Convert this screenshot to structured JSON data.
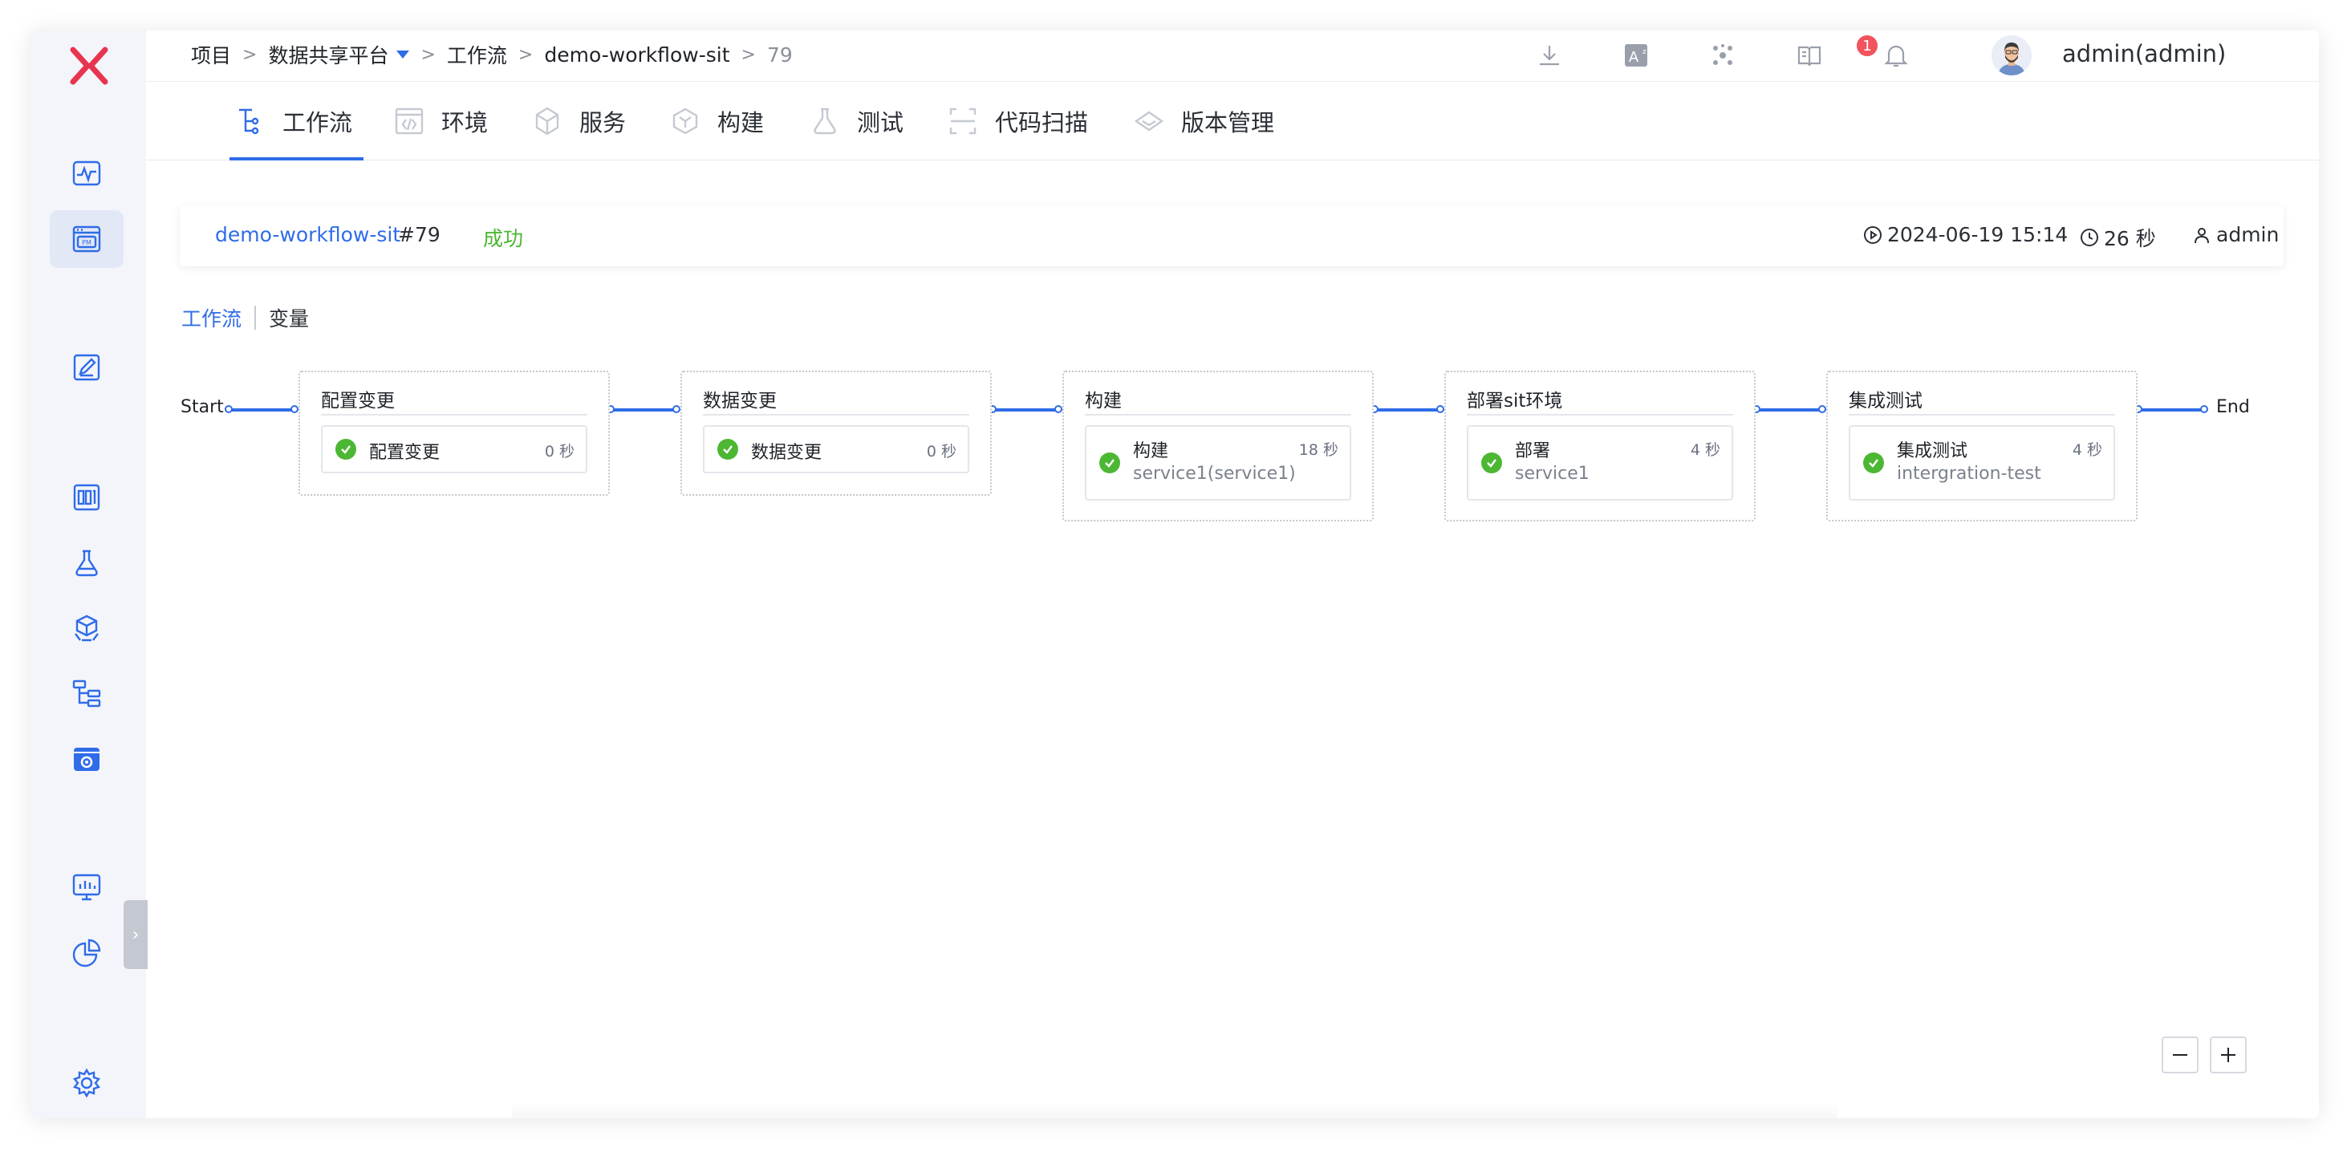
{
  "breadcrumb": [
    "项目",
    "数据共享平台",
    "工作流",
    "demo-workflow-sit",
    "79"
  ],
  "breadcrumb_separator": ">",
  "topbar": {
    "icons": [
      "download-icon",
      "translate-icon",
      "network-icon",
      "docs-icon",
      "bell-icon"
    ],
    "notification_count": "1",
    "username": "admin(admin)"
  },
  "tabs": [
    {
      "label": "工作流",
      "icon": "workflow-icon",
      "active": true
    },
    {
      "label": "环境",
      "icon": "environment-icon"
    },
    {
      "label": "服务",
      "icon": "service-icon"
    },
    {
      "label": "构建",
      "icon": "build-icon"
    },
    {
      "label": "测试",
      "icon": "test-icon"
    },
    {
      "label": "代码扫描",
      "icon": "scan-icon"
    },
    {
      "label": "版本管理",
      "icon": "version-icon"
    }
  ],
  "task": {
    "workflow_name": "demo-workflow-sit",
    "run_number": "#79",
    "status": "成功",
    "start_time": "2024-06-19 15:14",
    "duration": "26 秒",
    "creator": "admin"
  },
  "subtabs": [
    "工作流",
    "变量"
  ],
  "pipeline": {
    "start_label": "Start",
    "end_label": "End",
    "stages": [
      {
        "title": "配置变更",
        "job": {
          "name": "配置变更",
          "time": "0 秒",
          "sub": ""
        }
      },
      {
        "title": "数据变更",
        "job": {
          "name": "数据变更",
          "time": "0 秒",
          "sub": ""
        }
      },
      {
        "title": "构建",
        "job": {
          "name": "构建",
          "time": "18 秒",
          "sub": "service1(service1)"
        }
      },
      {
        "title": "部署sit环境",
        "job": {
          "name": "部署",
          "time": "4 秒",
          "sub": "service1"
        }
      },
      {
        "title": "集成测试",
        "job": {
          "name": "集成测试",
          "time": "4 秒",
          "sub": "intergration-test"
        }
      }
    ]
  },
  "sidebar": {
    "items": [
      "logo-icon",
      "monitor-icon",
      "project-icon",
      "edit-icon",
      "report-icon",
      "flask-icon",
      "package-icon",
      "tree-icon",
      "settings-box-icon",
      "dashboard-icon",
      "pie-chart-icon",
      "gear-icon"
    ],
    "active": "project-icon"
  },
  "zoom": {
    "out": "zoom-out-icon",
    "in": "zoom-in-icon"
  },
  "colors": {
    "accent": "#2f6ce8",
    "success": "#4cb733",
    "badge": "#f1545c",
    "logo": "#e8354f"
  }
}
